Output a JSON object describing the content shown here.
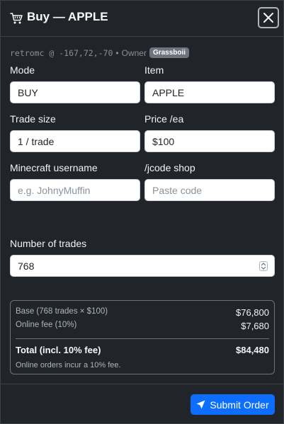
{
  "header": {
    "title": "Buy — APPLE",
    "cart_icon": "cart-icon",
    "close_icon": "close-icon"
  },
  "meta": {
    "coords": "retromc @ -167,72,-70",
    "separator": "•",
    "owner_label": "Owner",
    "owner_badge": "Grassboii"
  },
  "form": {
    "mode": {
      "label": "Mode",
      "value": "BUY"
    },
    "item": {
      "label": "Item",
      "value": "APPLE"
    },
    "trade_size": {
      "label": "Trade size",
      "value": "1 / trade"
    },
    "price": {
      "label": "Price /ea",
      "value": "$100"
    },
    "username": {
      "label": "Minecraft username",
      "placeholder": "e.g. JohnyMuffin"
    },
    "jcode": {
      "label": "/jcode shop",
      "placeholder": "Paste code"
    },
    "trades": {
      "label": "Number of trades",
      "value": "768"
    }
  },
  "summary": {
    "base_label": "Base (768 trades × $100)",
    "base_value": "$76,800",
    "fee_label": "Online fee (10%)",
    "fee_value": "$7,680",
    "total_label": "Total (incl. 10% fee)",
    "total_value": "$84,480",
    "note": "Online orders incur a 10% fee."
  },
  "footer": {
    "submit_label": "Submit Order",
    "submit_icon": "send-icon"
  },
  "colors": {
    "background": "#212529",
    "accent": "#0d6efd",
    "badge": "#6c757d"
  }
}
